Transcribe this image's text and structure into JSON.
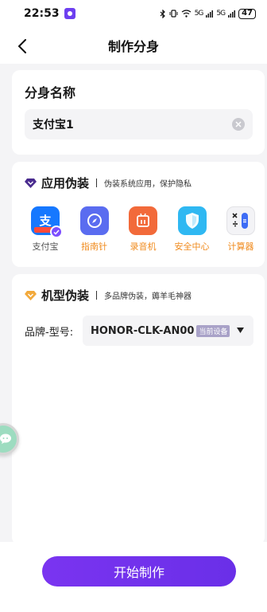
{
  "status_bar": {
    "time": "22:53",
    "signal_1": "5G",
    "signal_2": "5G",
    "battery": "47"
  },
  "header": {
    "title": "制作分身"
  },
  "name_section": {
    "label": "分身名称",
    "input_value": "支付宝1"
  },
  "app_disguise": {
    "title": "应用伪装",
    "subtitle": "伪装系统应用，保护隐私",
    "apps": [
      {
        "label": "支付宝",
        "icon": "alipay-icon",
        "selected": true
      },
      {
        "label": "指南针",
        "icon": "compass-icon",
        "selected": false
      },
      {
        "label": "录音机",
        "icon": "recorder-icon",
        "selected": false
      },
      {
        "label": "安全中心",
        "icon": "security-icon",
        "selected": false
      },
      {
        "label": "计算器",
        "icon": "calculator-icon",
        "selected": false
      }
    ]
  },
  "model_disguise": {
    "title": "机型伪装",
    "subtitle": "多品牌伪装，薅羊毛神器",
    "field_label": "品牌-型号:",
    "selected_model": "HONOR-CLK-AN00",
    "badge": "当前设备"
  },
  "footer": {
    "start_label": "开始制作"
  },
  "colors": {
    "accent": "#6a2fe8",
    "app_label_highlight": "#f08a1c"
  }
}
